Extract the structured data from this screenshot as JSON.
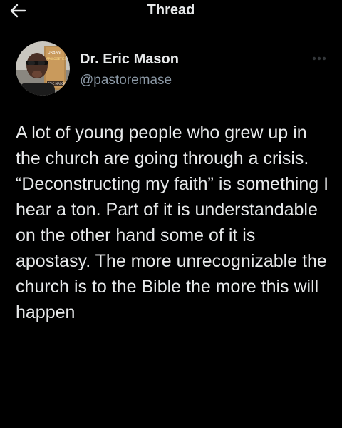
{
  "header": {
    "title": "Thread",
    "back_icon": "back-arrow-icon"
  },
  "author": {
    "name": "Dr. Eric Mason",
    "handle": "@pastoremase",
    "avatar_book_text": [
      "URBAN",
      "APOLOGETICS",
      "ERIC MASON"
    ]
  },
  "tweet": {
    "text": "A lot of young people who grew up in the church are going through a crisis.\n“Deconstructing my faith” is something I hear a ton. Part of it is understandable on the other hand some of it is apostasy. The more unrecognizable the church is to the Bible the more this will happen"
  },
  "more_icon": "more-options-icon",
  "colors": {
    "background": "#000000",
    "text_primary": "#e7e9ea",
    "text_secondary": "#8b98a5",
    "icon_muted": "#333639"
  }
}
